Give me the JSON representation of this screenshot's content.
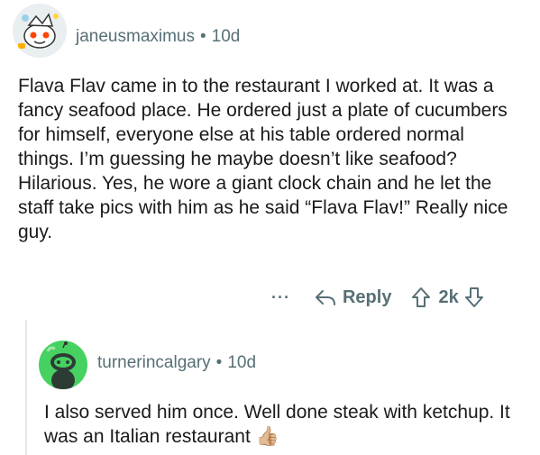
{
  "comment": {
    "username": "janeusmaximus",
    "separator": "•",
    "age": "10d",
    "body": "Flava Flav came in to the restaurant I worked at. It was a fancy seafood place. He ordered just a plate of cucumbers for himself, everyone else at his table ordered normal things. I’m guessing he maybe doesn’t like seafood? Hilarious. Yes, he wore a giant clock chain and he let the staff take pics with him as he said “Flava Flav!” Really nice guy.",
    "actions": {
      "more_label": "···",
      "reply_label": "Reply",
      "score": "2k"
    }
  },
  "reply": {
    "username": "turnerincalgary",
    "separator": "•",
    "age": "10d",
    "body": "I also served him once. Well done steak with ketchup. It was an Italian restaurant",
    "emoji": "👍🏼"
  },
  "colors": {
    "text": "#1a1a1b",
    "meta": "#576f76",
    "snoo_green": "#46d160",
    "avatar_bg_1": "#e9eef1"
  },
  "icons": {
    "avatar_1": "snoo-avatar-icon",
    "avatar_2": "snoo-avatar-icon",
    "reply": "reply-arrow-icon",
    "upvote": "upvote-arrow-icon",
    "downvote": "downvote-arrow-icon",
    "more": "more-options-icon"
  }
}
